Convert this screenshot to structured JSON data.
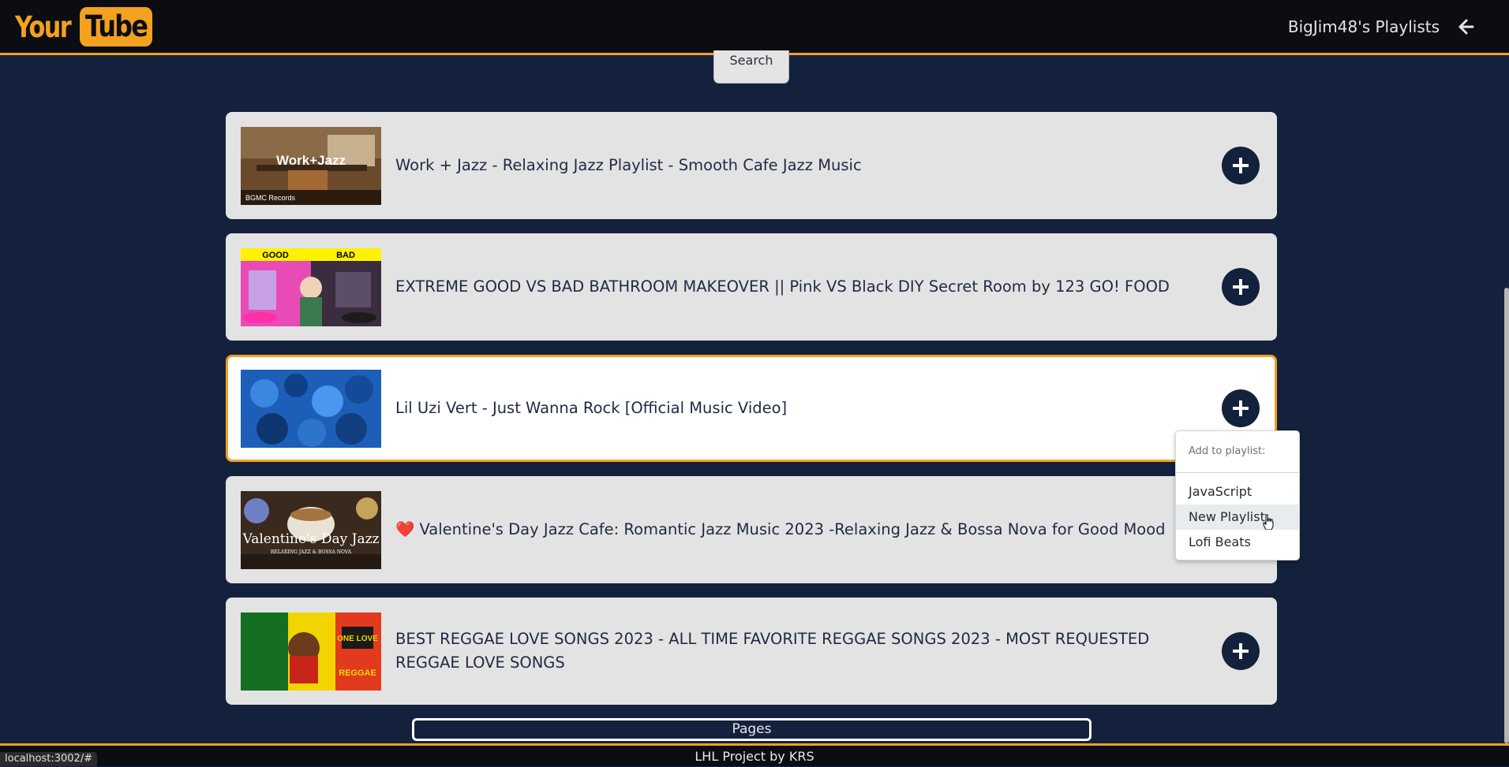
{
  "header": {
    "logo_your": "Your",
    "logo_tube": "Tube",
    "user_playlists": "BigJim48's Playlists"
  },
  "search": {
    "button_label": "Search"
  },
  "videos": [
    {
      "title": "Work + Jazz - Relaxing Jazz Playlist - Smooth Cafe Jazz Music",
      "thumb_text": "Work+Jazz",
      "thumb_sub": "BGMC Records"
    },
    {
      "title": "EXTREME GOOD VS BAD BATHROOM MAKEOVER || Pink VS Black DIY Secret Room by 123 GO! FOOD",
      "thumb_good": "GOOD",
      "thumb_bad": "BAD"
    },
    {
      "title": "Lil Uzi Vert - Just Wanna Rock [Official Music Video]"
    },
    {
      "title": "❤️ Valentine's Day Jazz Cafe: Romantic Jazz Music 2023 -Relaxing Jazz & Bossa Nova for Good Mood",
      "thumb_text": "Valentine's Day Jazz",
      "thumb_sub": "RELAXING JAZZ & BOSSA NOVA"
    },
    {
      "title": "BEST REGGAE LOVE SONGS 2023 - ALL TIME FAVORITE REGGAE SONGS 2023 - MOST REQUESTED REGGAE LOVE SONGS",
      "thumb_text": "ONE LOVE",
      "thumb_sub": "REGGAE"
    }
  ],
  "playlist_menu": {
    "header": "Add to playlist:",
    "items": [
      "JavaScript",
      "New Playlist",
      "Lofi Beats"
    ],
    "hovered": "New Playlist"
  },
  "pagination": {
    "label": "Pages"
  },
  "footer": {
    "text": "LHL Project by KRS"
  },
  "status_bar": {
    "url": "localhost:3002/#"
  },
  "colors": {
    "accent": "#f4a11e",
    "navy": "#13213c",
    "card": "#e3e3e3"
  }
}
